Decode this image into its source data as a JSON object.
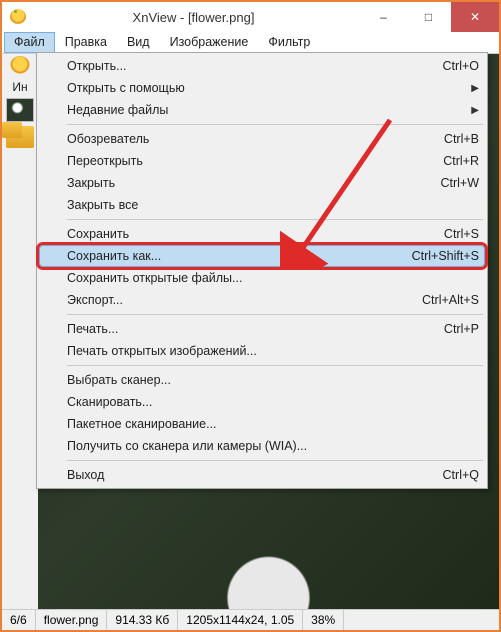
{
  "title": "XnView - [flower.png]",
  "menubar": {
    "file": "Файл",
    "edit": "Правка",
    "view": "Вид",
    "image": "Изображение",
    "filter": "Фильтр"
  },
  "sidebar": {
    "label": "Ин"
  },
  "dropdown": {
    "open": "Открыть...",
    "open_sc": "Ctrl+O",
    "open_with": "Открыть с помощью",
    "recent": "Недавние файлы",
    "browser": "Обозреватель",
    "browser_sc": "Ctrl+B",
    "reopen": "Переоткрыть",
    "reopen_sc": "Ctrl+R",
    "close": "Закрыть",
    "close_sc": "Ctrl+W",
    "close_all": "Закрыть все",
    "save": "Сохранить",
    "save_sc": "Ctrl+S",
    "save_as": "Сохранить как...",
    "save_as_sc": "Ctrl+Shift+S",
    "save_open": "Сохранить открытые файлы...",
    "export": "Экспорт...",
    "export_sc": "Ctrl+Alt+S",
    "print": "Печать...",
    "print_sc": "Ctrl+P",
    "print_open": "Печать открытых изображений...",
    "select_scanner": "Выбрать сканер...",
    "scan": "Сканировать...",
    "batch_scan": "Пакетное сканирование...",
    "wia": "Получить со сканера или камеры (WIA)...",
    "exit": "Выход",
    "exit_sc": "Ctrl+Q"
  },
  "status": {
    "index": "6/6",
    "filename": "flower.png",
    "size": "914.33 Кб",
    "dims": "1205x1144x24, 1.05",
    "zoom": "38%"
  }
}
